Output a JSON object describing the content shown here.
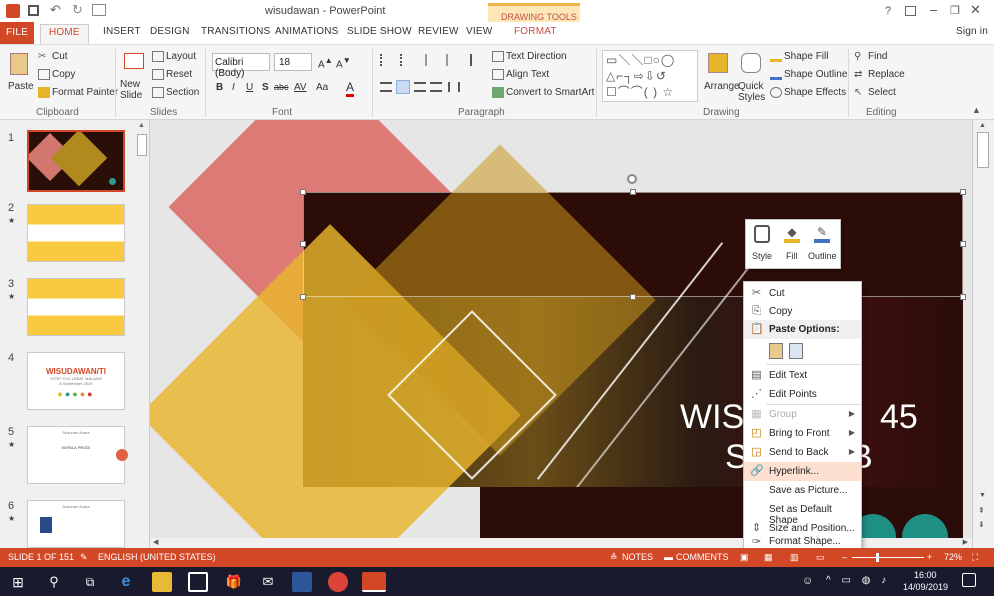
{
  "window": {
    "title": "wisudawan - PowerPoint",
    "contextual_group": "DRAWING TOOLS",
    "help": "?",
    "sign_in": "Sign in"
  },
  "tabs": [
    "FILE",
    "HOME",
    "INSERT",
    "DESIGN",
    "TRANSITIONS",
    "ANIMATIONS",
    "SLIDE SHOW",
    "REVIEW",
    "VIEW",
    "FORMAT"
  ],
  "ribbon": {
    "clipboard": {
      "paste": "Paste",
      "cut": "Cut",
      "copy": "Copy",
      "format_painter": "Format Painter",
      "label": "Clipboard"
    },
    "slides": {
      "new_slide": "New Slide",
      "layout": "Layout",
      "reset": "Reset",
      "section": "Section",
      "label": "Slides"
    },
    "font": {
      "name": "Calibri (Body)",
      "size": "18",
      "label": "Font",
      "bold": "B",
      "italic": "I",
      "underline": "U",
      "shadow": "S",
      "strike": "abc",
      "spacing": "AV",
      "case": "Aa"
    },
    "paragraph": {
      "text_direction": "Text Direction",
      "align_text": "Align Text",
      "smartart": "Convert to SmartArt",
      "label": "Paragraph"
    },
    "drawing": {
      "arrange": "Arrange",
      "quick_styles": "Quick Styles",
      "shape_fill": "Shape Fill",
      "shape_outline": "Shape Outline",
      "shape_effects": "Shape Effects",
      "label": "Drawing"
    },
    "editing": {
      "find": "Find",
      "replace": "Replace",
      "select": "Select",
      "label": "Editing"
    }
  },
  "thumbnails": [
    {
      "num": "1",
      "star": ""
    },
    {
      "num": "2",
      "star": "★"
    },
    {
      "num": "3",
      "star": "★"
    },
    {
      "num": "4",
      "star": "",
      "title": "WISUDAWAN/TI",
      "sub": "STOP YOU LEBAT MALANG",
      "date": "8 September 2019"
    },
    {
      "num": "5",
      "star": "★",
      "line1": "Susunan Acara",
      "line2": "KEPALA PRODI"
    },
    {
      "num": "6",
      "star": "★",
      "line1": "Susunan Acara"
    }
  ],
  "slide": {
    "text_line1": "WISU",
    "text_line1b": "45",
    "text_line2": "S",
    "text_line2b": "B"
  },
  "mini_toolbar": [
    "Style",
    "Fill",
    "Outline"
  ],
  "context_menu": [
    {
      "label": "Cut",
      "icon": "scissors-icon",
      "disabled": false,
      "submenu": false
    },
    {
      "label": "Copy",
      "icon": "copy-icon",
      "disabled": false,
      "submenu": false
    },
    {
      "label": "Paste Options:",
      "icon": "paste-icon",
      "disabled": false,
      "submenu": false,
      "header": true
    },
    {
      "label": "",
      "icon": "paste-option-icons",
      "disabled": false,
      "submenu": false
    },
    {
      "label": "Edit Text",
      "icon": "edit-text-icon",
      "disabled": false,
      "submenu": false
    },
    {
      "label": "Edit Points",
      "icon": "edit-points-icon",
      "disabled": false,
      "submenu": false
    },
    {
      "label": "Group",
      "icon": "group-icon",
      "disabled": true,
      "submenu": true
    },
    {
      "label": "Bring to Front",
      "icon": "bring-front-icon",
      "disabled": false,
      "submenu": true
    },
    {
      "label": "Send to Back",
      "icon": "send-back-icon",
      "disabled": false,
      "submenu": true
    },
    {
      "label": "Hyperlink...",
      "icon": "hyperlink-icon",
      "disabled": false,
      "submenu": false,
      "highlight": true
    },
    {
      "label": "Save as Picture...",
      "icon": "",
      "disabled": false,
      "submenu": false
    },
    {
      "label": "Set as Default Shape",
      "icon": "",
      "disabled": false,
      "submenu": false
    },
    {
      "label": "Size and Position...",
      "icon": "size-icon",
      "disabled": false,
      "submenu": false
    },
    {
      "label": "Format Shape...",
      "icon": "format-shape-icon",
      "disabled": false,
      "submenu": false
    }
  ],
  "status": {
    "slide": "SLIDE 1 OF 151",
    "language": "ENGLISH (UNITED STATES)",
    "notes": "NOTES",
    "comments": "COMMENTS",
    "zoom": "72%"
  },
  "taskbar": {
    "time": "16:00",
    "date": "14/09/2019"
  },
  "colors": {
    "accent": "#d24726",
    "slide_dark": "#2a0e08",
    "salmon": "#e07a74",
    "gold": "#e6b428",
    "highlight": "#fde0cf"
  }
}
